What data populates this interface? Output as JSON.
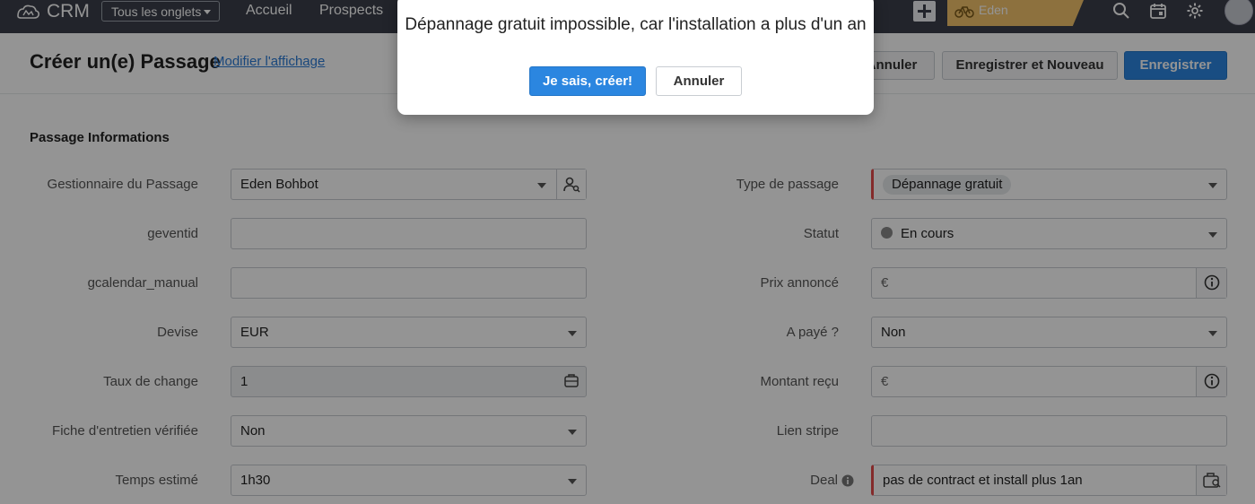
{
  "app": {
    "name": "CRM",
    "tabs_select": "Tous les onglets",
    "nav": [
      {
        "label": "Accueil"
      },
      {
        "label": "Prospects"
      }
    ],
    "user_tag": "Eden"
  },
  "header": {
    "title": "Créer un(e) Passage",
    "modify_layout": "Modifier l'affichage",
    "cancel_label": "Annuler",
    "save_new_label": "Enregistrer et Nouveau",
    "save_label": "Enregistrer"
  },
  "section": {
    "title": "Passage Informations"
  },
  "fields_left": {
    "manager": {
      "label": "Gestionnaire du Passage",
      "value": "Eden Bohbot"
    },
    "geventid": {
      "label": "geventid",
      "value": ""
    },
    "gcalendar": {
      "label": "gcalendar_manual",
      "value": ""
    },
    "currency": {
      "label": "Devise",
      "value": "EUR"
    },
    "rate": {
      "label": "Taux de change",
      "value": "1"
    },
    "maintenance": {
      "label": "Fiche d'entretien vérifiée",
      "value": "Non"
    },
    "duration": {
      "label": "Temps estimé",
      "value": "1h30"
    }
  },
  "fields_right": {
    "type": {
      "label": "Type de passage",
      "value": "Dépannage gratuit"
    },
    "status": {
      "label": "Statut",
      "value": "En cours"
    },
    "price": {
      "label": "Prix annoncé",
      "symbol": "€",
      "value": ""
    },
    "paid": {
      "label": "A payé ?",
      "value": "Non"
    },
    "received": {
      "label": "Montant reçu",
      "symbol": "€",
      "value": ""
    },
    "stripe": {
      "label": "Lien stripe",
      "value": ""
    },
    "deal": {
      "label": "Deal",
      "value": "pas de contract et install plus 1an"
    }
  },
  "dialog": {
    "message": "Dépannage gratuit impossible, car l'installation a plus d'un an",
    "confirm_label": "Je sais, créer!",
    "cancel_label": "Annuler"
  },
  "colors": {
    "topbar": "#3b3f4a",
    "primary": "#2b86e0",
    "tag": "#f3c36b",
    "mandatory": "#e34b4b"
  },
  "icons": [
    "crm-logo-icon",
    "chevron-down-icon",
    "plus-icon",
    "bike-icon",
    "search-icon",
    "calendar-icon",
    "gear-icon",
    "user-search-icon",
    "calculator-icon",
    "info-icon",
    "lookup-icon"
  ]
}
